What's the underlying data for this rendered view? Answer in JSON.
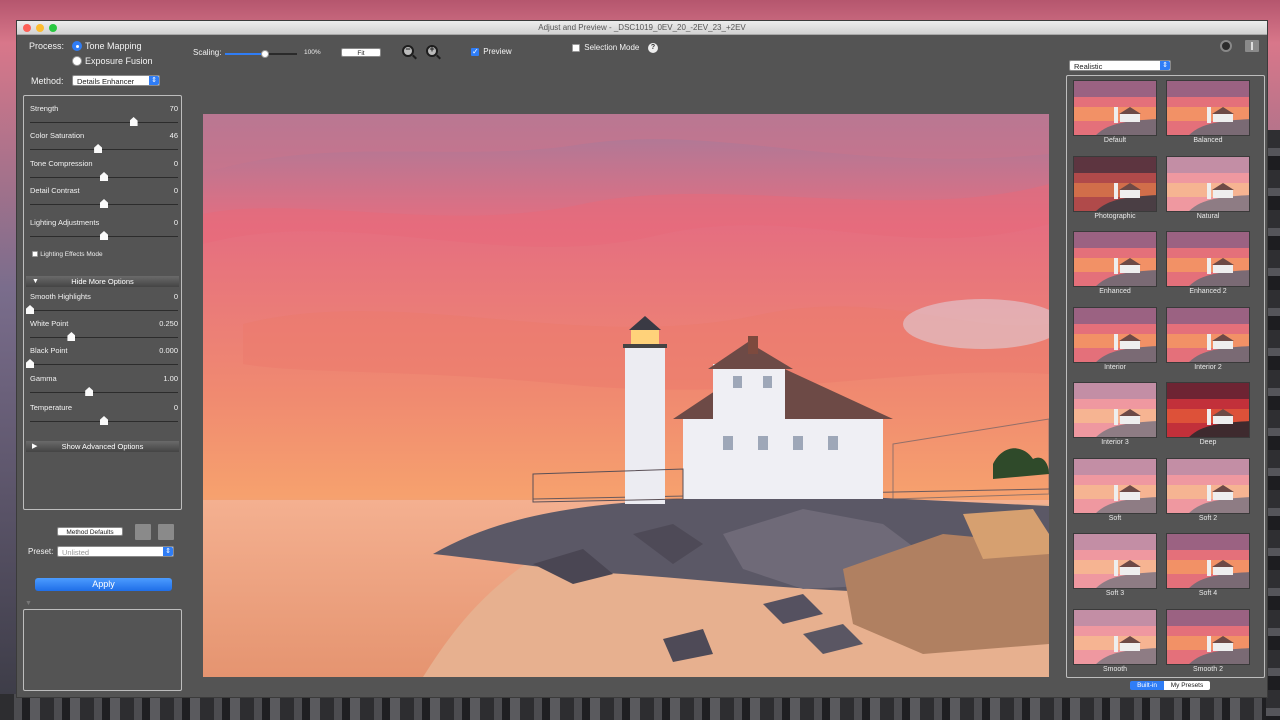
{
  "window": {
    "title": "Adjust and Preview - _DSC1019_0EV_20_-2EV_23_+2EV"
  },
  "process": {
    "label": "Process:",
    "options": [
      "Tone Mapping",
      "Exposure Fusion"
    ],
    "selected": "Tone Mapping"
  },
  "method": {
    "label": "Method:",
    "value": "Details Enhancer"
  },
  "toolbar": {
    "scaling_label": "Scaling:",
    "scaling_value": "100%",
    "scaling_level": 0.55,
    "fit_label": "Fit",
    "preview_label": "Preview",
    "preview_checked": true,
    "selection_mode_label": "Selection Mode",
    "selection_mode_checked": false,
    "help_glyph": "?"
  },
  "sliders": [
    {
      "name": "Strength",
      "value": "70",
      "level": 0.7
    },
    {
      "name": "Color Saturation",
      "value": "46",
      "level": 0.46
    },
    {
      "name": "Tone Compression",
      "value": "0",
      "level": 0.5
    },
    {
      "name": "Detail Contrast",
      "value": "0",
      "level": 0.5
    },
    {
      "name": "Lighting Adjustments",
      "value": "0",
      "level": 0.5
    }
  ],
  "lighting_effects": {
    "label": "Lighting Effects Mode",
    "checked": false
  },
  "more_options": {
    "label": "Hide More Options",
    "sliders": [
      {
        "name": "Smooth Highlights",
        "value": "0",
        "level": 0.0
      },
      {
        "name": "White Point",
        "value": "0.250",
        "level": 0.28
      },
      {
        "name": "Black Point",
        "value": "0.000",
        "level": 0.0
      },
      {
        "name": "Gamma",
        "value": "1.00",
        "level": 0.4
      },
      {
        "name": "Temperature",
        "value": "0",
        "level": 0.5
      }
    ]
  },
  "advanced_options": {
    "label": "Show Advanced Options"
  },
  "method_defaults_label": "Method Defaults",
  "preset": {
    "label": "Preset:",
    "value": "Unlisted"
  },
  "apply_label": "Apply",
  "presets_dropdown": {
    "value": "Realistic"
  },
  "thumbnails": [
    {
      "label": "Default",
      "tone": "warm"
    },
    {
      "label": "Balanced",
      "tone": "warm"
    },
    {
      "label": "Photographic",
      "tone": "dark"
    },
    {
      "label": "Natural",
      "tone": "soft"
    },
    {
      "label": "Enhanced",
      "tone": "warm"
    },
    {
      "label": "Enhanced 2",
      "tone": "warm"
    },
    {
      "label": "Interior",
      "tone": "warm"
    },
    {
      "label": "Interior 2",
      "tone": "warm"
    },
    {
      "label": "Interior 3",
      "tone": "soft"
    },
    {
      "label": "Deep",
      "tone": "deep"
    },
    {
      "label": "Soft",
      "tone": "soft"
    },
    {
      "label": "Soft 2",
      "tone": "soft"
    },
    {
      "label": "Soft 3",
      "tone": "soft"
    },
    {
      "label": "Soft 4",
      "tone": "warm"
    },
    {
      "label": "Smooth",
      "tone": "soft"
    },
    {
      "label": "Smooth 2",
      "tone": "warm"
    }
  ],
  "preset_tabs": [
    "Built-in",
    "My Presets"
  ],
  "colors": {
    "accent": "#2f7df6",
    "panel": "#545454",
    "window_border": "#3b3b3b"
  }
}
